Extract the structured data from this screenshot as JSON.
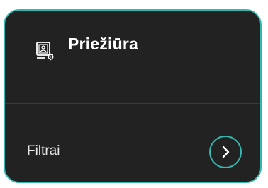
{
  "card": {
    "title": "Priežiūra",
    "title_icon": "maintenance-icon",
    "accent_color": "#33b7ae",
    "background_color": "#222222"
  },
  "rows": [
    {
      "label": "Filtrai",
      "action_icon": "chevron-right-icon"
    }
  ]
}
